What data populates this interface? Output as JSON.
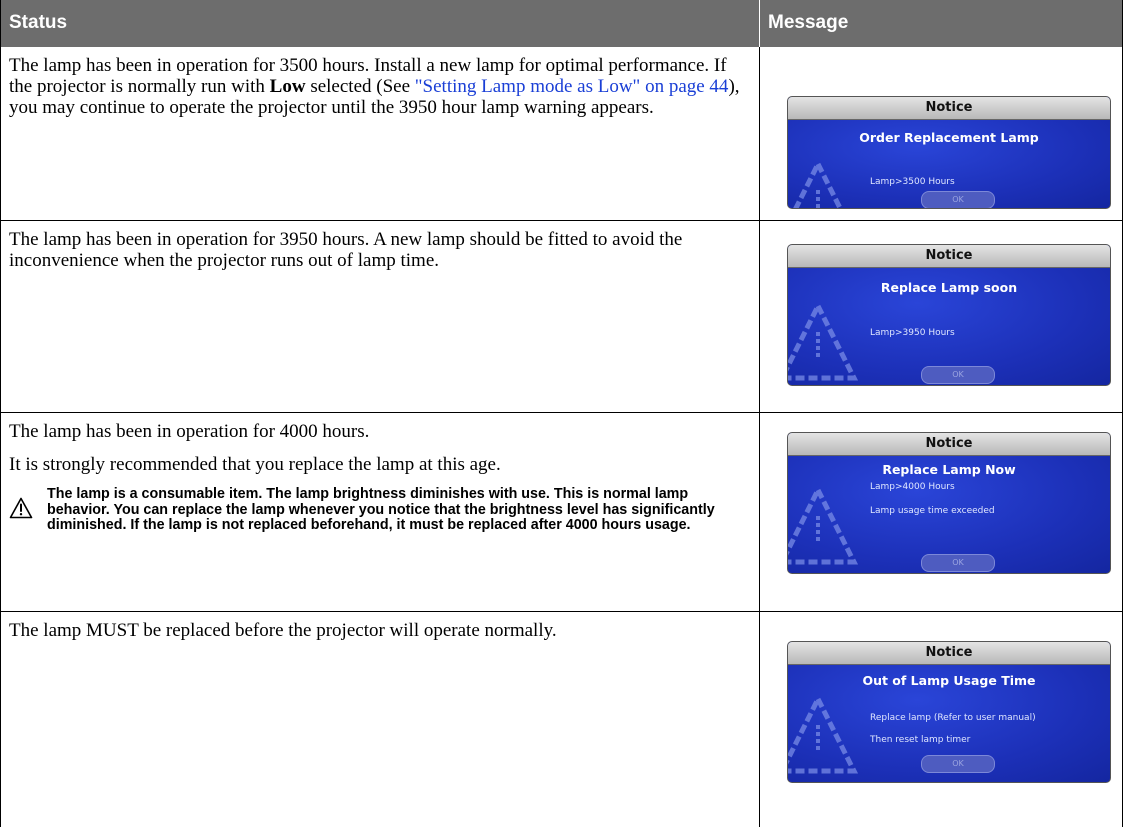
{
  "header": {
    "status": "Status",
    "message": "Message"
  },
  "rows": [
    {
      "status_parts": {
        "a": "The lamp has been in operation for 3500 hours. Install a new lamp for optimal performance. If the projector is normally run with ",
        "bold": "Low",
        "b": " selected (See ",
        "link": "\"Setting Lamp mode as Low\" on page 44",
        "c": "), you may continue to operate the projector until the 3950 hour lamp warning appears."
      },
      "dialog": {
        "title": "Notice",
        "heading": "Order Replacement Lamp",
        "line1": "Lamp>3500 Hours",
        "line2": "",
        "ok": "OK"
      }
    },
    {
      "status": "The lamp has been in operation for 3950 hours. A new lamp should be fitted to avoid the inconvenience when the projector runs out of lamp time.",
      "dialog": {
        "title": "Notice",
        "heading": "Replace Lamp soon",
        "line1": "Lamp>3950 Hours",
        "line2": "",
        "ok": "OK"
      }
    },
    {
      "status": "The lamp has been in operation for 4000 hours.",
      "status2": "It is strongly recommended that you replace the lamp at this age.",
      "warning": "The lamp is a consumable item. The lamp brightness diminishes with use. This is normal lamp behavior. You can replace the lamp whenever you notice that the brightness level has significantly diminished. If the lamp is not replaced beforehand, it must be replaced after 4000 hours usage.",
      "dialog": {
        "title": "Notice",
        "heading": "Replace Lamp Now",
        "line1": "Lamp>4000 Hours",
        "line2": "Lamp usage time exceeded",
        "ok": "OK"
      }
    },
    {
      "status": "The lamp MUST be replaced before the projector will operate normally.",
      "dialog": {
        "title": "Notice",
        "heading": "Out of Lamp Usage Time",
        "line1": "Replace lamp (Refer to user manual)",
        "line2": "Then reset lamp timer",
        "ok": "OK"
      }
    }
  ]
}
